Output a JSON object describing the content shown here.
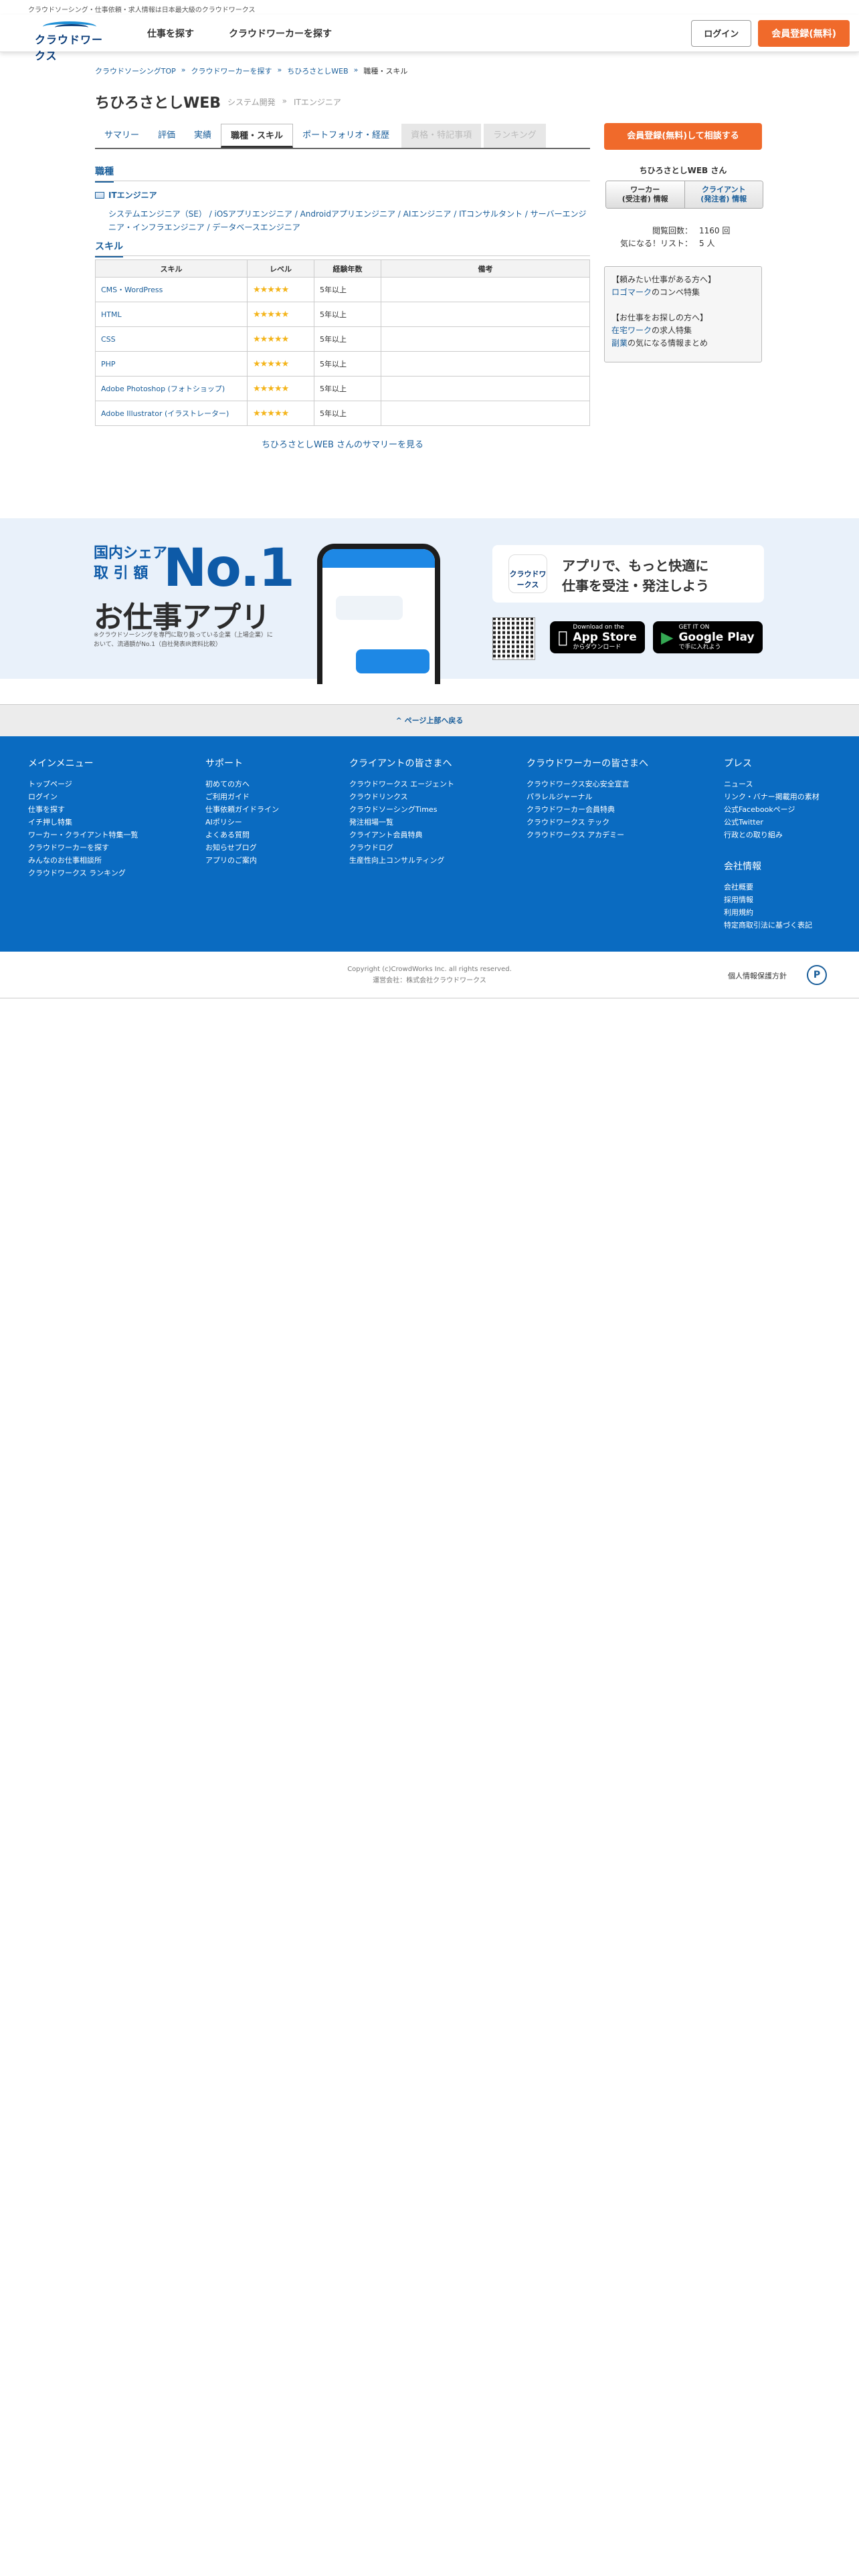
{
  "tagline": "クラウドソーシング・仕事依頼・求人情報は日本最大級のクラウドワークス",
  "logo_text": "クラウドワークス",
  "nav": {
    "find_jobs": "仕事を探す",
    "find_workers": "クラウドワーカーを探す"
  },
  "header": {
    "login": "ログイン",
    "register": "会員登録(無料)"
  },
  "breadcrumb": [
    "クラウドソーシングTOP",
    "クラウドワーカーを探す",
    "ちひろさとしWEB",
    "職種・スキル"
  ],
  "breadcrumb_sep": "»",
  "profile": {
    "name": "ちひろさとしWEB",
    "tag1": "システム開発",
    "tag2": "ITエンジニア"
  },
  "tabs": {
    "summary": "サマリー",
    "reviews": "評価",
    "results": "実績",
    "skills": "職種・スキル",
    "portfolio": "ポートフォリオ・経歴",
    "qualifications": "資格・特記事項",
    "ranking": "ランキング"
  },
  "jobs_section": {
    "heading": "職種",
    "category": "ITエンジニア",
    "roles": "システムエンジニア（SE） / iOSアプリエンジニア / Androidアプリエンジニア / AIエンジニア / ITコンサルタント / サーバーエンジニア・インフラエンジニア / データベースエンジニア"
  },
  "skills_section": {
    "heading": "スキル",
    "headers": {
      "skill": "スキル",
      "level": "レベル",
      "years": "経験年数",
      "note": "備考"
    },
    "rows": [
      {
        "skill": "CMS・WordPress",
        "stars": "★★★★★",
        "years": "5年以上",
        "note": ""
      },
      {
        "skill": "HTML",
        "stars": "★★★★★",
        "years": "5年以上",
        "note": ""
      },
      {
        "skill": "CSS",
        "stars": "★★★★★",
        "years": "5年以上",
        "note": ""
      },
      {
        "skill": "PHP",
        "stars": "★★★★★",
        "years": "5年以上",
        "note": ""
      },
      {
        "skill": "Adobe Photoshop (フォトショップ)",
        "stars": "★★★★★",
        "years": "5年以上",
        "note": ""
      },
      {
        "skill": "Adobe Illustrator (イラストレーター)",
        "stars": "★★★★★",
        "years": "5年以上",
        "note": ""
      }
    ],
    "summary_link": "ちひろさとしWEB さんのサマリーを見る"
  },
  "sidebar": {
    "cta": "会員登録(無料)して相談する",
    "name_title": "ちひろさとしWEB さん",
    "toggle_worker_1": "ワーカー",
    "toggle_worker_2": "(受注者) 情報",
    "toggle_client_1": "クライアント",
    "toggle_client_2": "(発注者) 情報",
    "views_label": "閲覧回数：",
    "views_value": "1160 回",
    "fav_label": "気になる！リスト：",
    "fav_value": "5 人",
    "box_line1": "【頼みたい仕事がある方へ】",
    "box_link1": "ロゴマーク",
    "box_line1b": "のコンペ特集",
    "box_line2": "【お仕事をお探しの方へ】",
    "box_link2": "在宅ワーク",
    "box_line2b": "の求人特集",
    "box_link3": "副業",
    "box_line3b": "の気になる情報まとめ"
  },
  "app_banner": {
    "share_1": "国内シェア",
    "share_2": "取 引 額",
    "no1": "No.1",
    "app_name": "お仕事アプリ",
    "note": "※クラウドソーシングを専門に取り扱っている企業（上場企業）において、流通額がNo.1（自社発表IR資料比較）",
    "callout_1": "アプリで、もっと快適に",
    "callout_2": "仕事を受注・発注しよう",
    "icon_text": "クラウドワークス",
    "appstore_small": "Download on the",
    "appstore_big": "App Store",
    "appstore_jp": "からダウンロード",
    "gplay_small": "GET IT ON",
    "gplay_big": "Google Play",
    "gplay_jp": "で手に入れよう"
  },
  "back_to_top": "^ ページ上部へ戻る",
  "footer": {
    "col1": {
      "title": "メインメニュー",
      "items": [
        "トップページ",
        "ログイン",
        "仕事を探す",
        "イチ押し特集",
        "ワーカー・クライアント特集一覧",
        "クラウドワーカーを探す",
        "みんなのお仕事相談所",
        "クラウドワークス ランキング"
      ]
    },
    "col2": {
      "title": "サポート",
      "items": [
        "初めての方へ",
        "ご利用ガイド",
        "仕事依頼ガイドライン",
        "AIポリシー",
        "よくある質問",
        "お知らせブログ",
        "アプリのご案内"
      ]
    },
    "col3": {
      "title": "クライアントの皆さまへ",
      "items": [
        "クラウドワークス エージェント",
        "クラウドリンクス",
        "クラウドソーシングTimes",
        "発注相場一覧",
        "クライアント会員特典",
        "クラウドログ",
        "生産性向上コンサルティング"
      ]
    },
    "col4": {
      "title": "クラウドワーカーの皆さまへ",
      "items": [
        "クラウドワークス安心安全宣言",
        "パラレルジャーナル",
        "クラウドワーカー会員特典",
        "クラウドワークス テック",
        "クラウドワークス アカデミー"
      ]
    },
    "col5": {
      "title": "プレス",
      "items": [
        "ニュース",
        "リンク・バナー掲載用の素材",
        "公式Facebookページ",
        "公式Twitter",
        "行政との取り組み"
      ]
    },
    "col6": {
      "title": "会社情報",
      "items": [
        "会社概要",
        "採用情報",
        "利用規約",
        "特定商取引法に基づく表記"
      ]
    }
  },
  "bottom": {
    "copyright": "Copyright (c)CrowdWorks Inc. all rights reserved.",
    "company": "運営会社：株式会社クラウドワークス",
    "privacy": "個人情報保護方針",
    "privacy_mark": "P"
  }
}
